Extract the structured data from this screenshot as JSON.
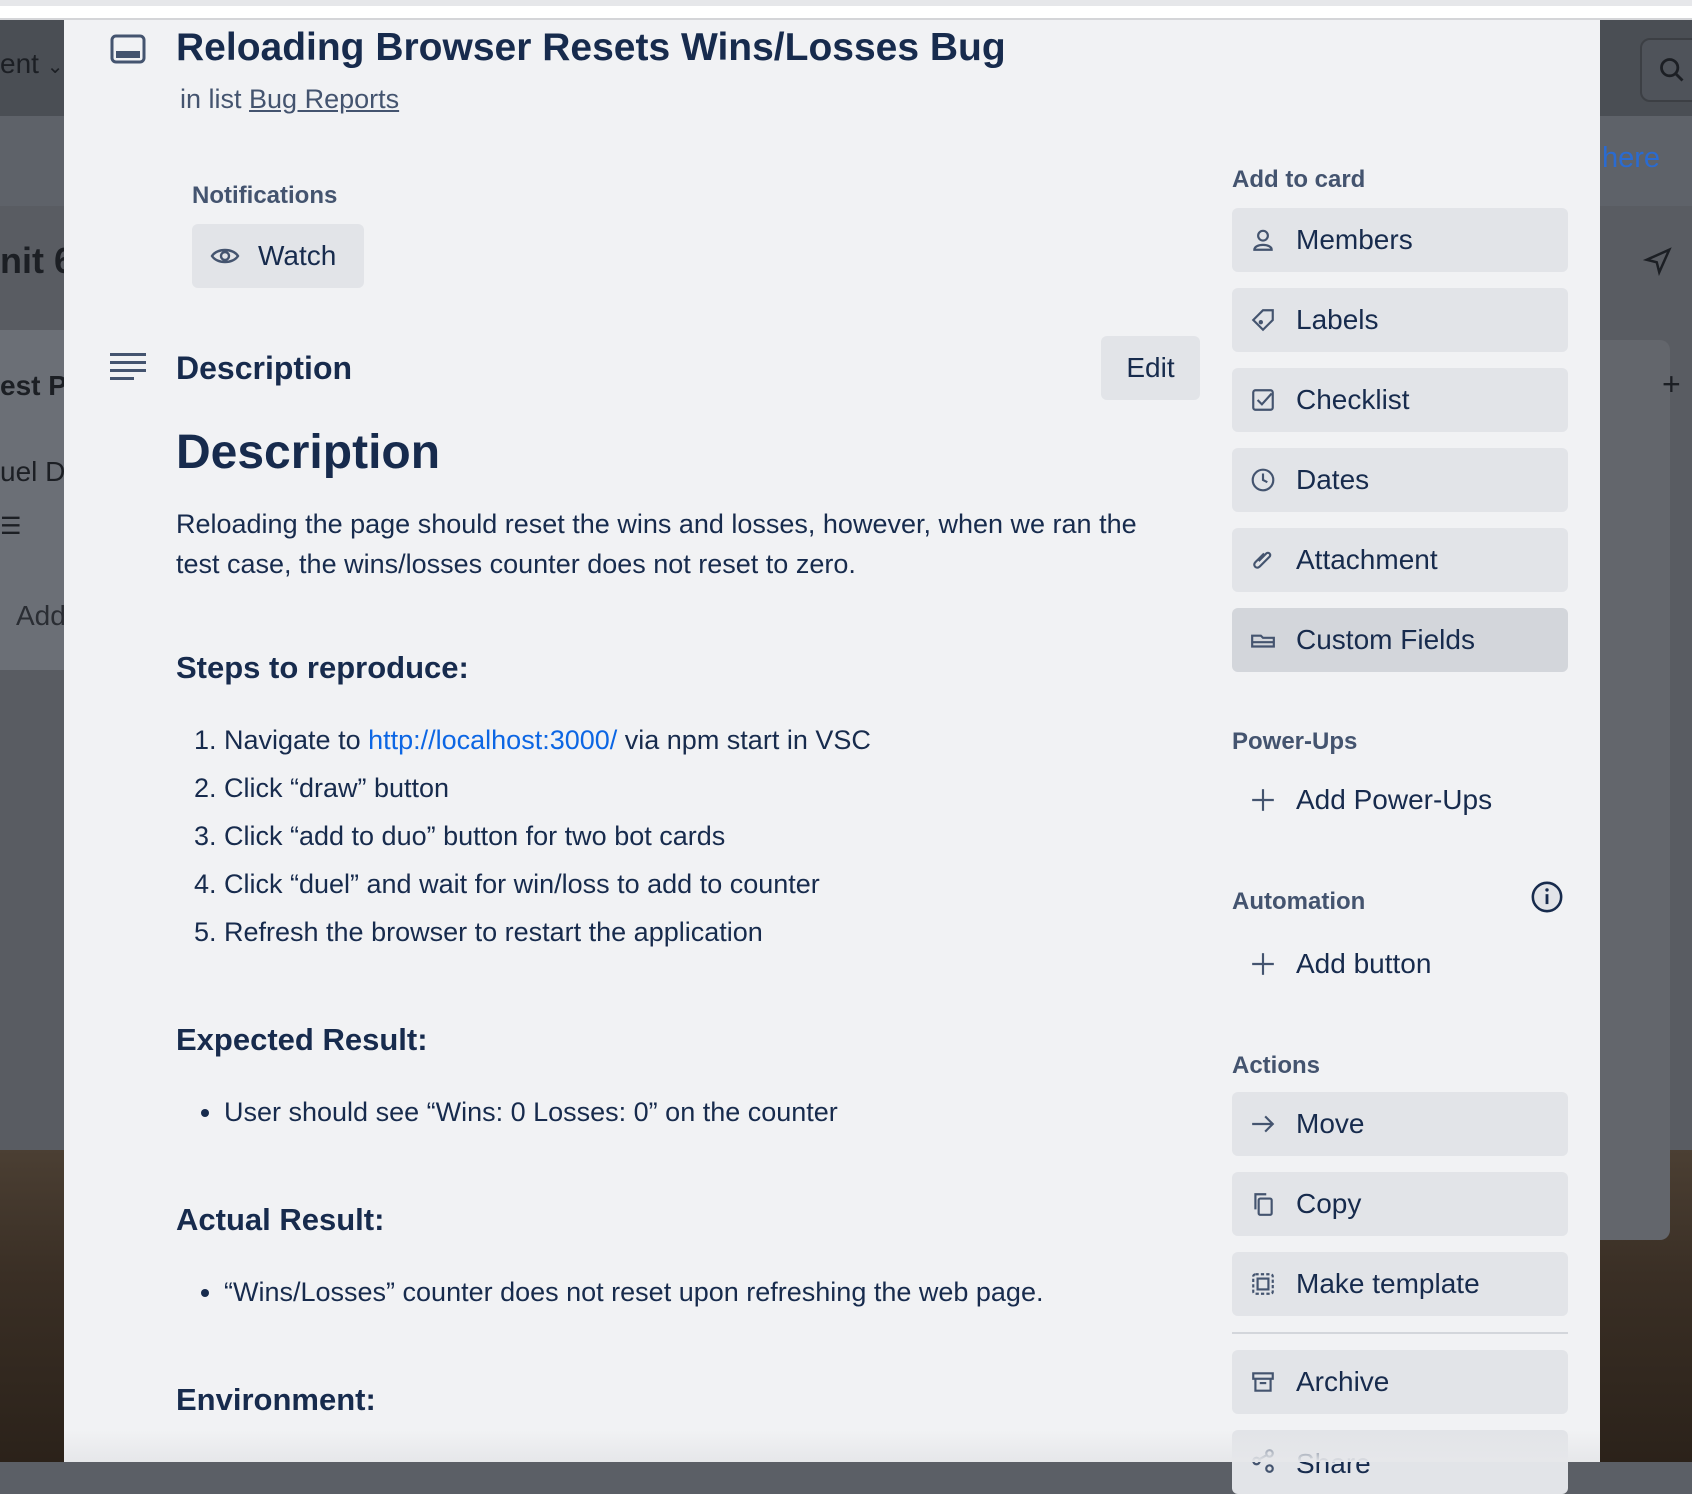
{
  "background": {
    "top_left_text": "ent",
    "here_link": "here",
    "nit_text": "nit 6",
    "est_text": "est Pl",
    "uel_text": "uel D",
    "add_text": "Add"
  },
  "card": {
    "title": "Reloading Browser Resets Wins/Losses Bug",
    "in_list_prefix": "in list",
    "list_name": "Bug Reports"
  },
  "notifications": {
    "label": "Notifications",
    "watch_label": "Watch"
  },
  "description": {
    "header": "Description",
    "edit_label": "Edit",
    "heading": "Description",
    "summary": "Reloading the page should reset the wins and losses, however, when we ran the test case, the wins/losses counter does not reset to zero.",
    "steps_heading": "Steps to reproduce:",
    "step1_prefix": "Navigate to ",
    "step1_link": "http://localhost:3000/",
    "step1_suffix": " via npm start in VSC",
    "step2": "Click “draw” button",
    "step3": "Click “add to duo” button for two bot cards",
    "step4": "Click “duel” and wait for win/loss to add to counter",
    "step5": "Refresh the browser to restart the application",
    "expected_heading": "Expected Result:",
    "expected_item": "User should see “Wins: 0 Losses: 0” on the counter",
    "actual_heading": "Actual Result:",
    "actual_item": "“Wins/Losses” counter does not reset upon refreshing the web page.",
    "environment_heading": "Environment:"
  },
  "sidebar": {
    "add_to_card_label": "Add to card",
    "members": "Members",
    "labels": "Labels",
    "checklist": "Checklist",
    "dates": "Dates",
    "attachment": "Attachment",
    "custom_fields": "Custom Fields",
    "powerups_label": "Power-Ups",
    "add_powerups": "Add Power-Ups",
    "automation_label": "Automation",
    "add_button": "Add button",
    "actions_label": "Actions",
    "move": "Move",
    "copy": "Copy",
    "make_template": "Make template",
    "archive": "Archive",
    "share": "Share"
  }
}
